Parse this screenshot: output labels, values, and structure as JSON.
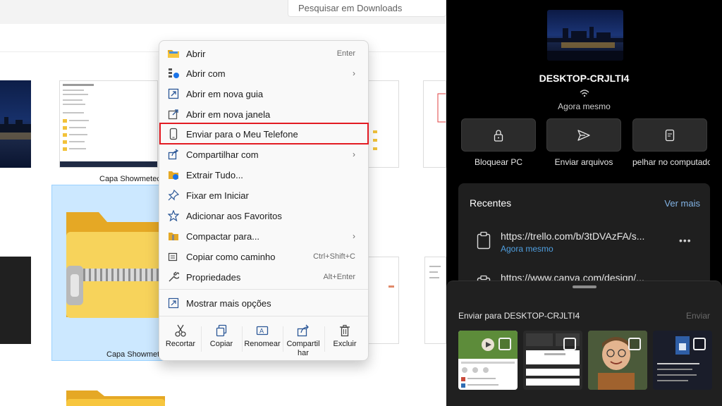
{
  "explorer": {
    "search_placeholder": "Pesquisar em Downloads",
    "thumbnails": [
      {
        "label": "Capa Showmetec"
      },
      {
        "label": "Capa Showmet"
      }
    ]
  },
  "context_menu": {
    "items": [
      {
        "label": "Abrir",
        "shortcut": "Enter",
        "icon": "folder-open-icon"
      },
      {
        "label": "Abrir com",
        "submenu": true,
        "icon": "open-with-icon"
      },
      {
        "label": "Abrir em nova guia",
        "icon": "new-tab-icon"
      },
      {
        "label": "Abrir em nova janela",
        "icon": "new-window-icon"
      },
      {
        "label": "Enviar para o Meu Telefone",
        "icon": "phone-icon",
        "highlighted": true
      },
      {
        "label": "Compartilhar com",
        "submenu": true,
        "icon": "share-with-icon"
      },
      {
        "label": "Extrair Tudo...",
        "icon": "extract-icon"
      },
      {
        "label": "Fixar em Iniciar",
        "icon": "pin-icon"
      },
      {
        "label": "Adicionar aos Favoritos",
        "icon": "star-icon"
      },
      {
        "label": "Compactar para...",
        "submenu": true,
        "icon": "compress-icon"
      },
      {
        "label": "Copiar como caminho",
        "shortcut": "Ctrl+Shift+C",
        "icon": "copy-path-icon"
      },
      {
        "label": "Propriedades",
        "shortcut": "Alt+Enter",
        "icon": "wrench-icon"
      },
      {
        "label": "Mostrar mais opções",
        "icon": "more-options-icon"
      }
    ],
    "actions": [
      {
        "label": "Recortar",
        "icon": "scissors-icon"
      },
      {
        "label": "Copiar",
        "icon": "copy-icon"
      },
      {
        "label": "Renomear",
        "icon": "rename-icon"
      },
      {
        "label_line1": "Compartil",
        "label_line2": "har",
        "icon": "share-icon"
      },
      {
        "label": "Excluir",
        "icon": "trash-icon"
      }
    ],
    "highlight_color": "#e31b23"
  },
  "phone_panel": {
    "pc_name": "DESKTOP-CRJLTI4",
    "status": "Agora mesmo",
    "quick_actions": [
      {
        "label": "Bloquear PC",
        "icon": "lock-icon"
      },
      {
        "label": "Enviar arquivos",
        "icon": "send-icon"
      },
      {
        "label": "pelhar no computado",
        "icon": "mirror-icon"
      }
    ],
    "recents": {
      "title": "Recentes",
      "more_label": "Ver mais",
      "items": [
        {
          "url": "https://trello.com/b/3tDVAzFA/s...",
          "time": "Agora mesmo"
        },
        {
          "url": "https://www.canva.com/design/..."
        }
      ]
    },
    "send_sheet": {
      "title": "Enviar para DESKTOP-CRJLTI4",
      "send_label": "Enviar"
    },
    "accent_color": "#4f9fe0"
  }
}
